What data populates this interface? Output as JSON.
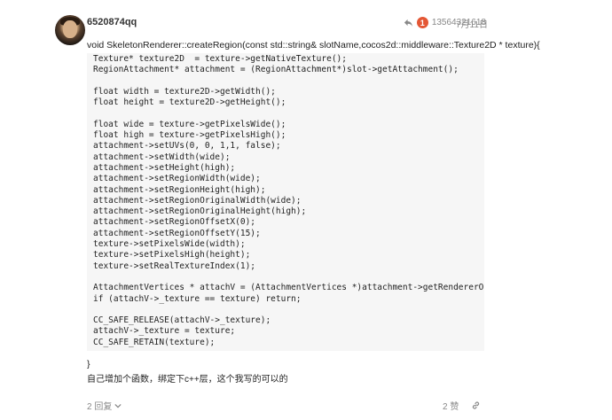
{
  "post": {
    "username": "6520874qq",
    "reply_to_count": "1",
    "reply_to_user": "13564321618",
    "date": "7月11日",
    "first_line": "void SkeletonRenderer::createRegion(const std::string& slotName,cocos2d::middleware::Texture2D * texture){",
    "code_lines": [
      "Texture* texture2D  = texture->getNativeTexture();",
      "RegionAttachment* attachment = (RegionAttachment*)slot->getAttachment();",
      "",
      "float width = texture2D->getWidth();",
      "float height = texture2D->getHeight();",
      "",
      "float wide = texture->getPixelsWide();",
      "float high = texture->getPixelsHigh();",
      "attachment->setUVs(0, 0, 1,1, false);",
      "attachment->setWidth(wide);",
      "attachment->setHeight(high);",
      "attachment->setRegionWidth(wide);",
      "attachment->setRegionHeight(high);",
      "attachment->setRegionOriginalWidth(wide);",
      "attachment->setRegionOriginalHeight(high);",
      "attachment->setRegionOffsetX(0);",
      "attachment->setRegionOffsetY(15);",
      "texture->setPixelsWide(width);",
      "texture->setPixelsHigh(height);",
      "texture->setRealTextureIndex(1);",
      "",
      "AttachmentVertices * attachV = (AttachmentVertices *)attachment->getRendererObject();",
      "if (attachV->_texture == texture) return;",
      "",
      "CC_SAFE_RELEASE(attachV->_texture);",
      "attachV->_texture = texture;",
      "CC_SAFE_RETAIN(texture);"
    ],
    "closing_brace": "}",
    "description": "自己增加个函数，绑定下c++层，这个我写的可以的",
    "replies_label": "2 回复",
    "likes_label": "2 赞"
  },
  "icons": [
    "reply-arrow-icon",
    "chevron-down-icon",
    "link-icon"
  ],
  "colors": {
    "badge": "#e45735",
    "code_bg": "#f6f6f6",
    "muted": "#888888"
  }
}
